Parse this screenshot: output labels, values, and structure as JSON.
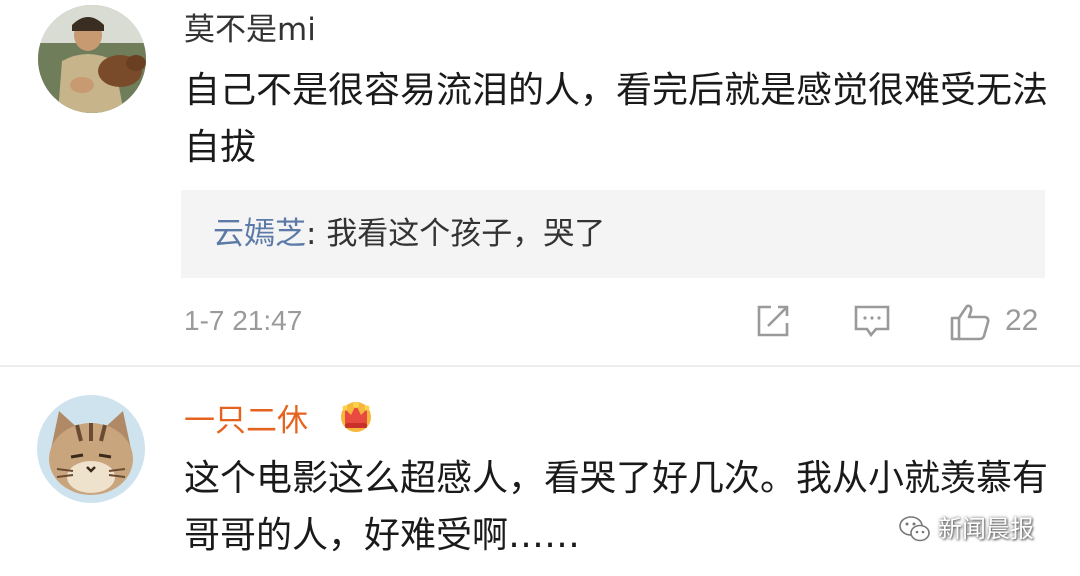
{
  "comments": [
    {
      "username": "莫不是mi",
      "text": "自己不是很容易流泪的人，看完后就是感觉很难受无法自拔",
      "reply": {
        "user": "云嫣芝",
        "separator": ": ",
        "text": "我看这个孩子，哭了"
      },
      "timestamp": "1-7 21:47",
      "likes": "22",
      "icons": [
        "share-icon",
        "comment-icon",
        "like-icon"
      ]
    },
    {
      "username": "一只二休",
      "username_color": "#e6621f",
      "badge_icon": "vip-crown-icon",
      "text": "这个电影这么超感人，看哭了好几次。我从小就羡慕有哥哥的人，好难受啊……"
    }
  ],
  "watermark": {
    "text": "新闻晨报",
    "icon": "wechat-icon"
  },
  "colors": {
    "reply_user": "#5b7aa8",
    "meta_gray": "#9a9a9a",
    "reply_background": "#f4f4f4"
  }
}
